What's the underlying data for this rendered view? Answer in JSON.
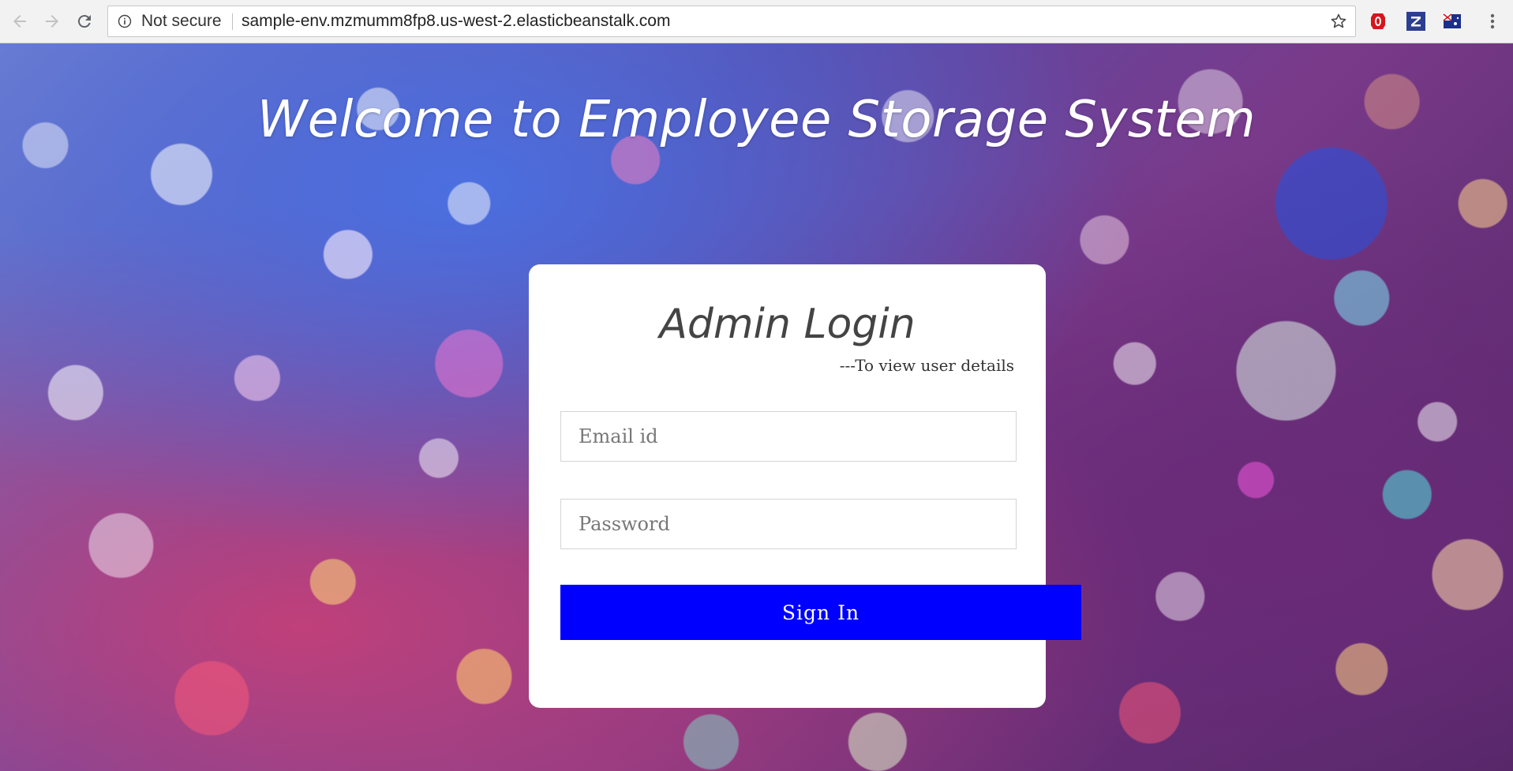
{
  "browser": {
    "security_label": "Not secure",
    "url": "sample-env.mzmumm8fp8.us-west-2.elasticbeanstalk.com",
    "icons": [
      "back-icon",
      "forward-icon",
      "reload-icon",
      "info-icon",
      "bookmark-star-icon",
      "opera-extension-icon",
      "z-extension-icon",
      "flag-extension-icon",
      "menu-icon"
    ]
  },
  "page": {
    "heading": "Welcome to Employee Storage System"
  },
  "login": {
    "title": "Admin Login",
    "subtitle": "---To view user details",
    "email_placeholder": "Email id",
    "email_value": "",
    "password_placeholder": "Password",
    "password_value": "",
    "submit_label": "Sign In"
  },
  "colors": {
    "button": "#0000ff",
    "card": "#ffffff"
  }
}
